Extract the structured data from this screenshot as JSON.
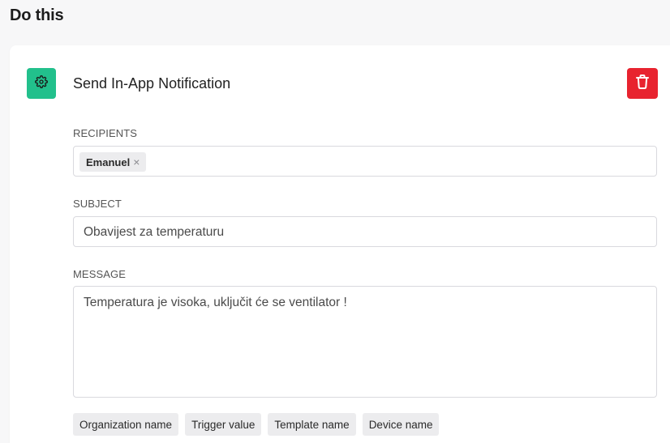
{
  "page": {
    "title": "Do this"
  },
  "action": {
    "icon": "gear-icon",
    "title": "Send In-App Notification",
    "delete_icon": "trash-icon",
    "accent_color": "#22c08c",
    "delete_color": "#e8232f"
  },
  "recipients": {
    "label": "RECIPIENTS",
    "tags": [
      {
        "name": "Emanuel",
        "remove_glyph": "×"
      }
    ]
  },
  "subject": {
    "label": "SUBJECT",
    "value": "Obavijest za temperaturu"
  },
  "message": {
    "label": "MESSAGE",
    "value": "Temperatura je visoka, uključit će se ventilator !"
  },
  "variables": [
    {
      "label": "Organization name"
    },
    {
      "label": "Trigger value"
    },
    {
      "label": "Template name"
    },
    {
      "label": "Device name"
    }
  ]
}
